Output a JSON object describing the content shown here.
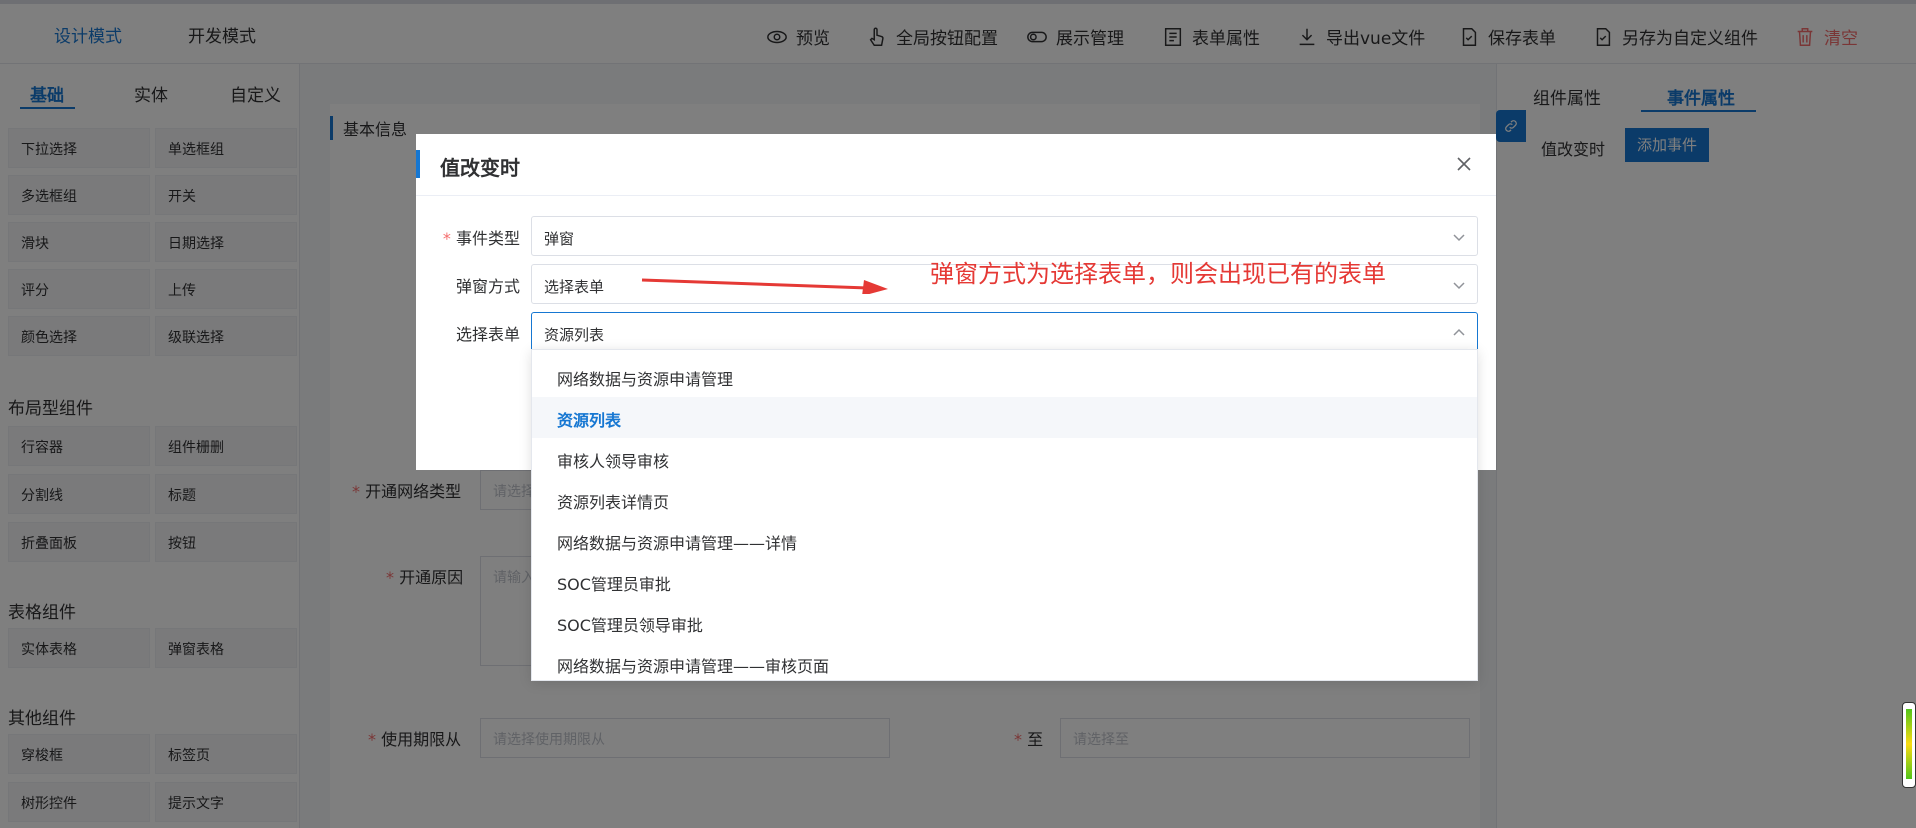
{
  "topbar": {
    "modes": [
      "设计模式",
      "开发模式"
    ],
    "tools": [
      {
        "icon": "eye-icon",
        "label": "预览"
      },
      {
        "icon": "pointer-icon",
        "label": "全局按钮配置"
      },
      {
        "icon": "toggle-icon",
        "label": "展示管理"
      },
      {
        "icon": "form-icon",
        "label": "表单属性"
      },
      {
        "icon": "download-icon",
        "label": "导出vue文件"
      },
      {
        "icon": "doc-save-icon",
        "label": "保存表单"
      },
      {
        "icon": "doc-save-icon",
        "label": "另存为自定义组件"
      },
      {
        "icon": "trash-icon",
        "label": "清空"
      }
    ]
  },
  "left_panel": {
    "tabs": [
      "基础",
      "实体",
      "自定义"
    ],
    "group_basic_items": [
      "下拉选择",
      "单选框组",
      "多选框组",
      "开关",
      "滑块",
      "日期选择",
      "评分",
      "上传",
      "颜色选择",
      "级联选择"
    ],
    "group_layout": {
      "title": "布局型组件",
      "items": [
        "行容器",
        "组件栅删",
        "分割线",
        "标题",
        "折叠面板",
        "按钮"
      ]
    },
    "group_table": {
      "title": "表格组件",
      "items": [
        "实体表格",
        "弹窗表格"
      ]
    },
    "group_other": {
      "title": "其他组件",
      "items": [
        "穿梭框",
        "标签页",
        "树形控件",
        "提示文字"
      ]
    }
  },
  "right_panel": {
    "tabs": [
      "组件属性",
      "事件属性"
    ],
    "event_label": "值改变时",
    "add_event_button": "添加事件"
  },
  "canvas": {
    "section_title": "基本信息",
    "fields": [
      {
        "label": "开通网络类型",
        "placeholder": "请选择"
      },
      {
        "label": "开通原因",
        "placeholder": "请输入"
      },
      {
        "label": "使用期限从",
        "placeholder": "请选择使用期限从"
      },
      {
        "label": "至",
        "placeholder": "请选择至"
      }
    ]
  },
  "modal": {
    "title": "值改变时",
    "fields": [
      {
        "label": "事件类型",
        "required": true,
        "value": "弹窗"
      },
      {
        "label": "弹窗方式",
        "required": false,
        "value": "选择表单"
      },
      {
        "label": "选择表单",
        "required": false,
        "value": "资源列表"
      }
    ]
  },
  "dropdown": {
    "options": [
      "网络数据与资源申请管理",
      "资源列表",
      "审核人领导审核",
      "资源列表详情页",
      "网络数据与资源申请管理——详情",
      "SOC管理员审批",
      "SOC管理员领导审批",
      "网络数据与资源申请管理——审核页面"
    ],
    "selected_index": 1
  },
  "annotation": "弹窗方式为选择表单，则会出现已有的表单",
  "colors": {
    "accent": "#1677d2",
    "danger": "#f56c6c",
    "annotation": "#e53935"
  }
}
